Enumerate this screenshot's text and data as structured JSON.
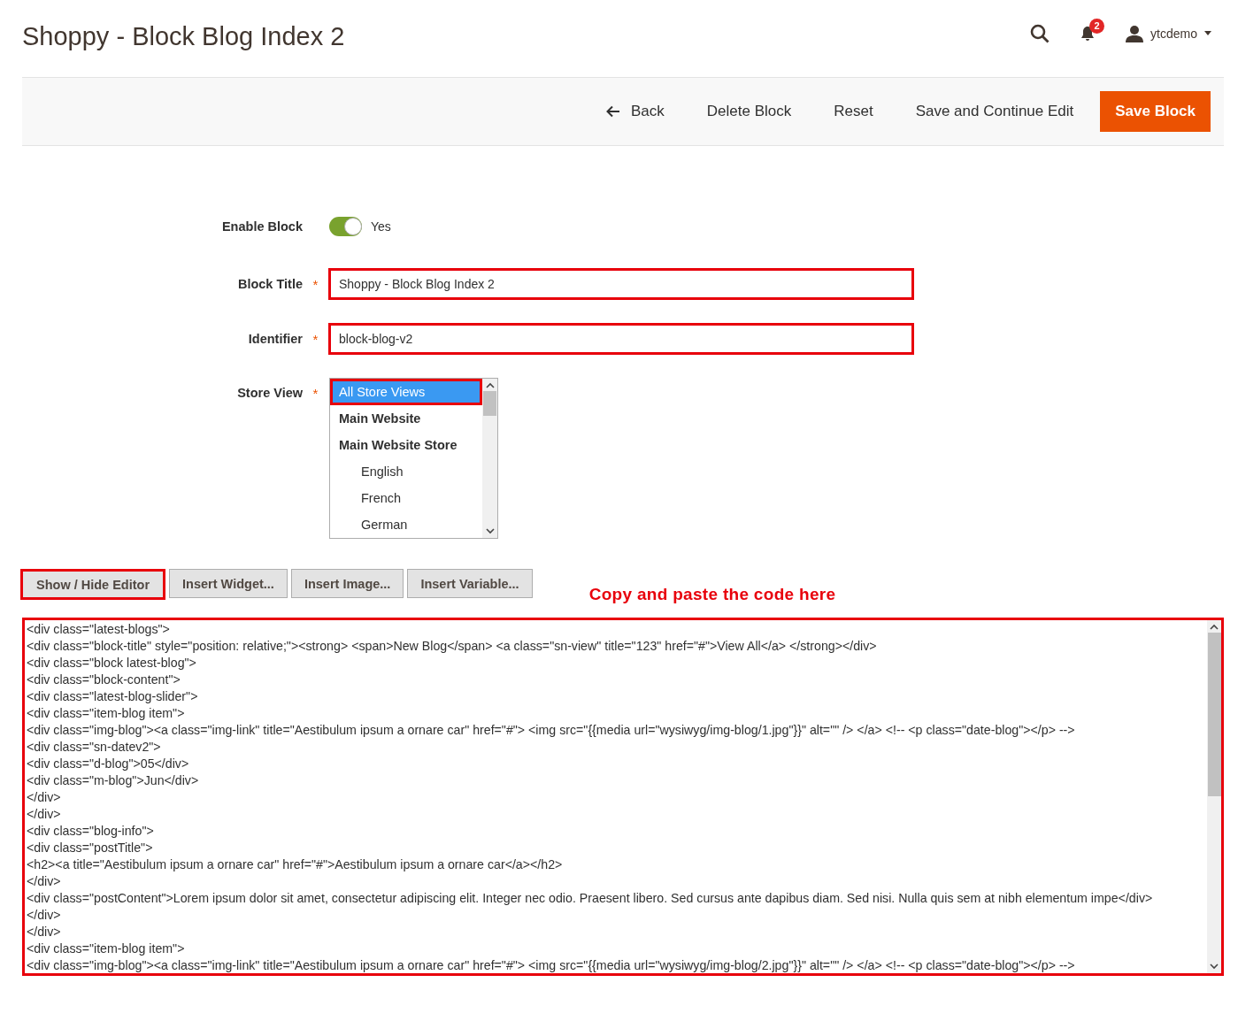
{
  "header": {
    "title": "Shoppy - Block Blog Index 2",
    "notifications": "2",
    "user": "ytcdemo"
  },
  "actions": [
    {
      "label": "Back",
      "kind": "back"
    },
    {
      "label": "Delete Block",
      "kind": "plain"
    },
    {
      "label": "Reset",
      "kind": "plain"
    },
    {
      "label": "Save and Continue Edit",
      "kind": "plain"
    },
    {
      "label": "Save Block",
      "kind": "primary"
    }
  ],
  "form": {
    "enable_block": {
      "label": "Enable Block",
      "on": true,
      "value": "Yes"
    },
    "block_title": {
      "label": "Block Title",
      "required_mark": "*",
      "value": "Shoppy - Block Blog Index 2",
      "highlighted": true
    },
    "identifier": {
      "label": "Identifier",
      "required_mark": "*",
      "value": "block-blog-v2",
      "highlighted": true
    },
    "store_view": {
      "label": "Store View",
      "required_mark": "*",
      "options": [
        {
          "label": "All Store Views",
          "selected": true,
          "highlighted": true
        },
        {
          "label": "Main Website",
          "selected": false,
          "highlighted": false,
          "children": [
            {
              "label": "Main Website Store",
              "selected": false,
              "highlighted": false,
              "children": [
                {
                  "label": "English",
                  "selected": false,
                  "highlighted": false
                },
                {
                  "label": "French",
                  "selected": false,
                  "highlighted": false
                },
                {
                  "label": "German",
                  "selected": false,
                  "highlighted": false
                }
              ]
            }
          ]
        }
      ]
    }
  },
  "editor_buttons": [
    {
      "label": "Show / Hide Editor",
      "highlighted": true
    },
    {
      "label": "Insert Widget...",
      "highlighted": false
    },
    {
      "label": "Insert Image...",
      "highlighted": false
    },
    {
      "label": "Insert Variable...",
      "highlighted": false
    }
  ],
  "annotation": "Copy and paste the code here",
  "code": {
    "highlighted": true,
    "lines": [
      "<div class=\"latest-blogs\">",
      "<div class=\"block-title\" style=\"position: relative;\"><strong> <span>New Blog</span> <a class=\"sn-view\" title=\"123\" href=\"#\">View All</a> </strong></div>",
      "<div class=\"block latest-blog\">",
      "<div class=\"block-content\">",
      "<div class=\"latest-blog-slider\">",
      "<div class=\"item-blog item\">",
      "<div class=\"img-blog\"><a class=\"img-link\" title=\"Aestibulum ipsum a ornare car\" href=\"#\"> <img src=\"{{media url=\"wysiwyg/img-blog/1.jpg\"}}\" alt=\"\" /> </a> <!-- <p class=\"date-blog\"></p> -->",
      "<div class=\"sn-datev2\">",
      "<div class=\"d-blog\">05</div>",
      "<div class=\"m-blog\">Jun</div>",
      "</div>",
      "</div>",
      "<div class=\"blog-info\">",
      "<div class=\"postTitle\">",
      "<h2><a title=\"Aestibulum ipsum a ornare car\" href=\"#\">Aestibulum ipsum a ornare car</a></h2>",
      "</div>",
      "<div class=\"postContent\">Lorem ipsum dolor sit amet, consectetur adipiscing elit. Integer nec odio. Praesent libero. Sed cursus ante dapibus diam. Sed nisi. Nulla quis sem at nibh elementum impe</div>",
      "</div>",
      "</div>",
      "<div class=\"item-blog item\">",
      "<div class=\"img-blog\"><a class=\"img-link\" title=\"Aestibulum ipsum a ornare car\" href=\"#\"> <img src=\"{{media url=\"wysiwyg/img-blog/2.jpg\"}}\" alt=\"\" /> </a> <!-- <p class=\"date-blog\"></p> -->"
    ]
  }
}
